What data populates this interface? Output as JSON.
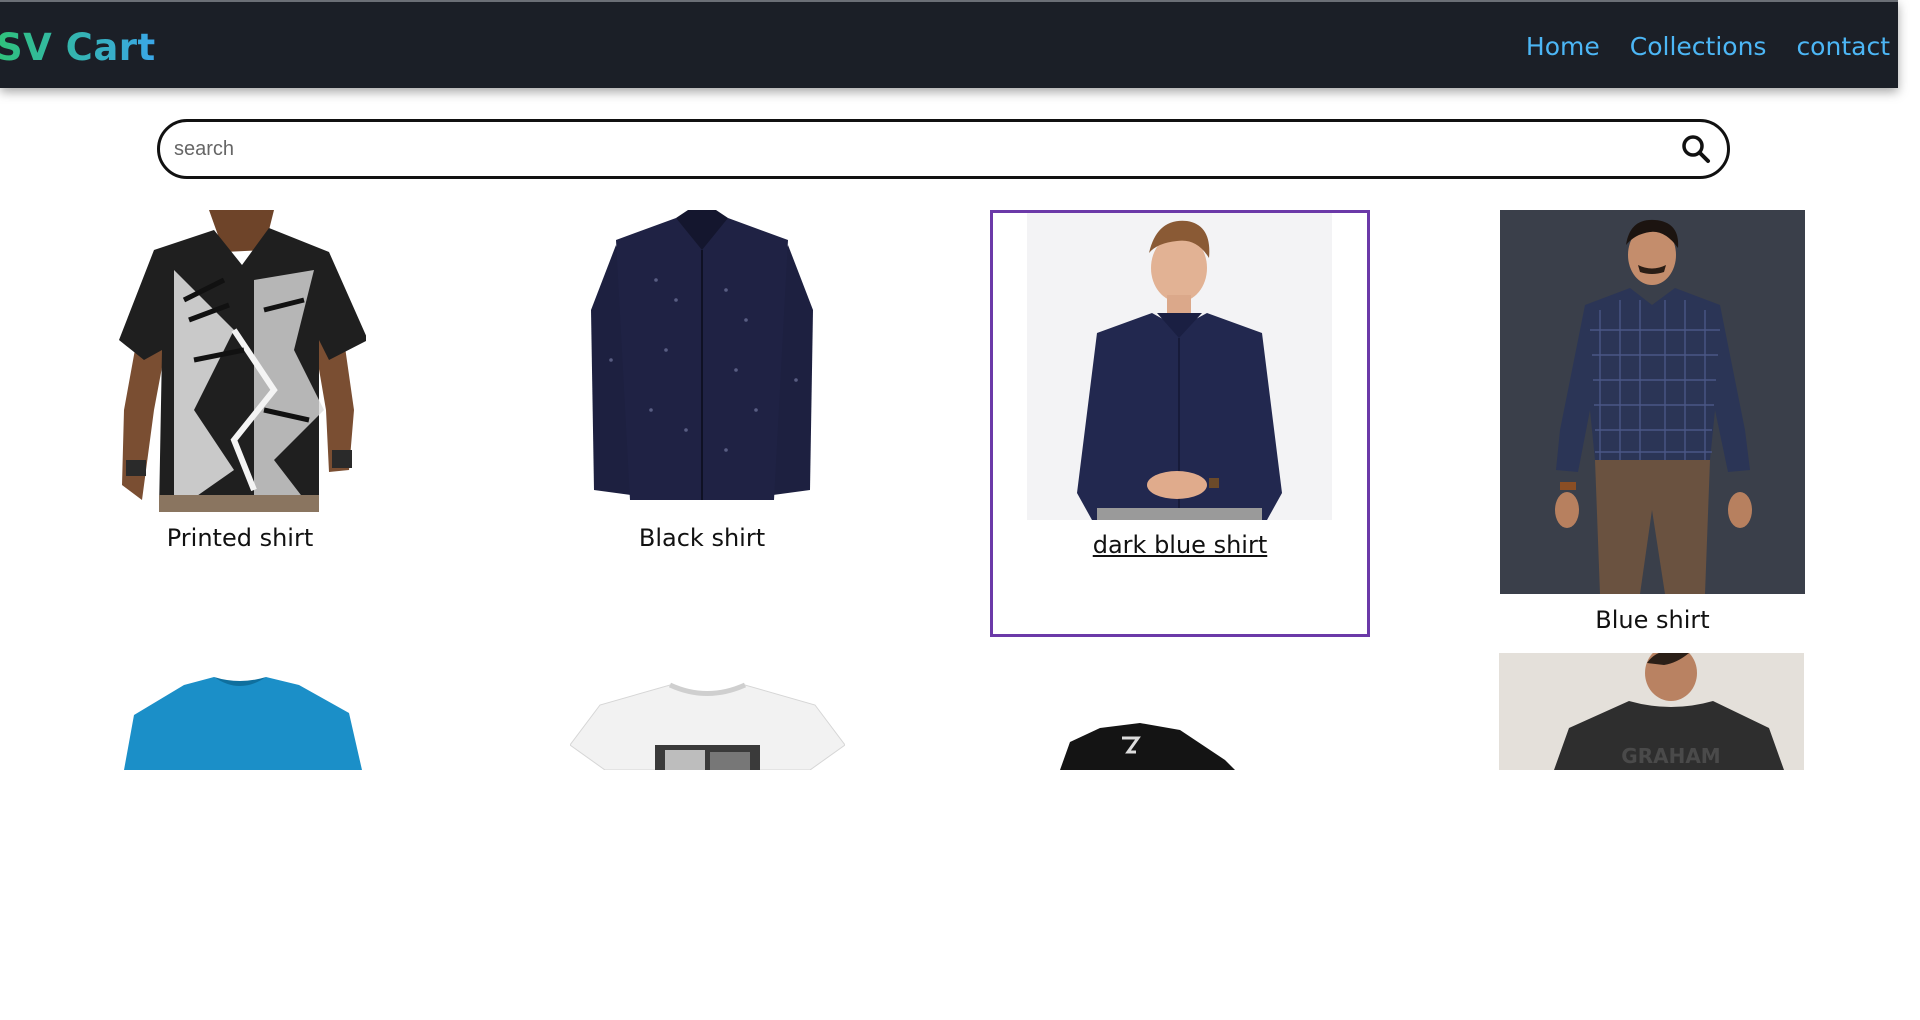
{
  "navbar": {
    "brand": "SV Cart",
    "links": [
      {
        "label": "Home"
      },
      {
        "label": "Collections"
      },
      {
        "label": "contact"
      }
    ]
  },
  "search": {
    "placeholder": "search",
    "value": "",
    "icon": "search-icon"
  },
  "products": [
    {
      "name": "Printed shirt"
    },
    {
      "name": "Black shirt"
    },
    {
      "name": "dark blue shirt"
    },
    {
      "name": "Blue shirt"
    }
  ],
  "colors": {
    "navbar_bg": "#1b1f27",
    "brand_green": "#2fc27a",
    "brand_blue": "#3aa6e8",
    "nav_link": "#4cb6f5",
    "focus_border": "#6b39a8"
  }
}
